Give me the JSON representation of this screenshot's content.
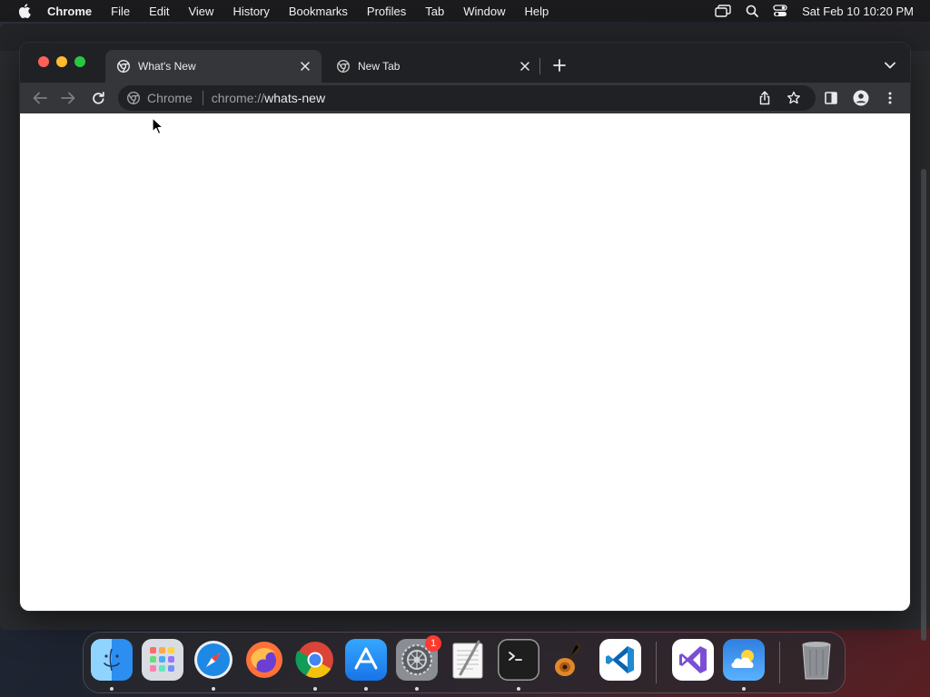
{
  "menubar": {
    "apple_icon": "apple-logo-icon",
    "items": [
      "Chrome",
      "File",
      "Edit",
      "View",
      "History",
      "Bookmarks",
      "Profiles",
      "Tab",
      "Window",
      "Help"
    ],
    "clock": "Sat Feb 10  10:20 PM",
    "status_icons": [
      "screen-mirroring-icon",
      "spotlight-search-icon",
      "control-center-icon"
    ]
  },
  "browser": {
    "tabs": [
      {
        "title": "What's New",
        "icon": "chrome-favicon",
        "active": true
      },
      {
        "title": "New Tab",
        "icon": "chrome-favicon",
        "active": false
      }
    ],
    "toolbar_icons": [
      "back-arrow-icon",
      "forward-arrow-icon",
      "reload-icon"
    ],
    "omnibox": {
      "chip_label": "Chrome",
      "url_scheme": "chrome://",
      "url_host": "whats-new"
    },
    "right_icons": [
      "share-icon",
      "bookmark-star-icon",
      "side-panel-icon",
      "profile-icon",
      "more-menu-icon"
    ]
  },
  "dock": {
    "apps": [
      {
        "name": "Finder",
        "running": true
      },
      {
        "name": "Launchpad",
        "running": false
      },
      {
        "name": "Safari",
        "running": true
      },
      {
        "name": "Firefox",
        "running": false
      },
      {
        "name": "Chrome",
        "running": true
      },
      {
        "name": "App Store",
        "running": true
      },
      {
        "name": "System Settings",
        "running": true,
        "badge": "1"
      },
      {
        "name": "TextEdit",
        "running": false
      },
      {
        "name": "Terminal",
        "running": true
      },
      {
        "name": "GarageBand",
        "running": false
      },
      {
        "name": "Visual Studio Code",
        "running": false
      },
      {
        "name": "Visual Studio",
        "running": false
      },
      {
        "name": "Weather",
        "running": true
      },
      {
        "name": "Trash",
        "running": false
      }
    ]
  },
  "colors": {
    "tab_strip": "#202124",
    "toolbar": "#35363a",
    "page": "#ffffff",
    "close": "#ff5f57",
    "minimize": "#febc2e",
    "maximize": "#28c840"
  }
}
